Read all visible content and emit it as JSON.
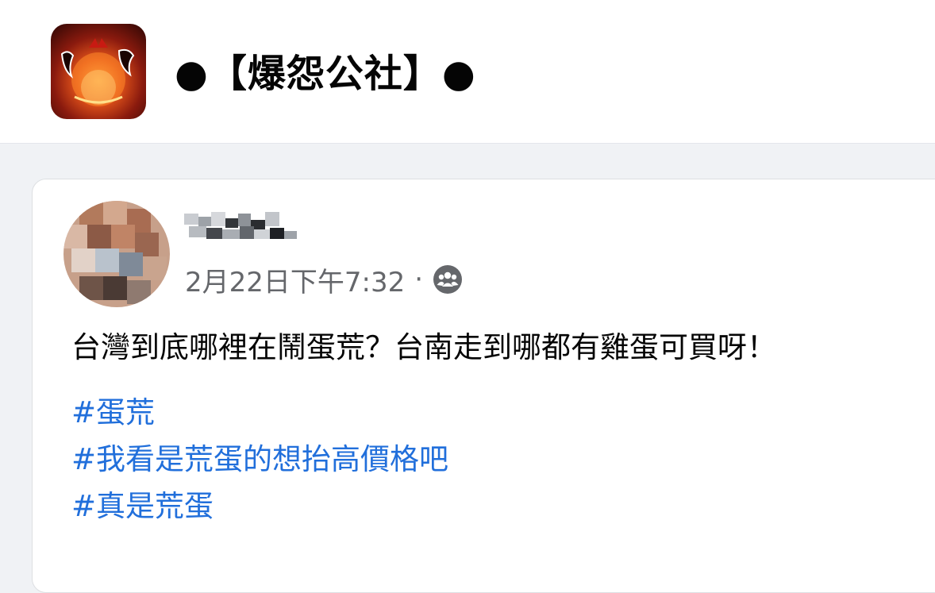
{
  "group": {
    "title": "●【爆怨公社】●",
    "avatar_icon": "group-logo-image"
  },
  "post": {
    "author_name_blurred": true,
    "timestamp": "2月22日下午7:32",
    "separator": "·",
    "privacy_icon": "group-members-icon",
    "body": "台灣到底哪裡在鬧蛋荒？台南走到哪都有雞蛋可買呀！",
    "hashtags": [
      "#蛋荒",
      "#我看是荒蛋的想抬高價格吧",
      "#真是荒蛋"
    ]
  },
  "colors": {
    "background": "#f0f2f5",
    "card": "#ffffff",
    "text": "#050505",
    "meta": "#65676b",
    "link": "#216fdb"
  }
}
